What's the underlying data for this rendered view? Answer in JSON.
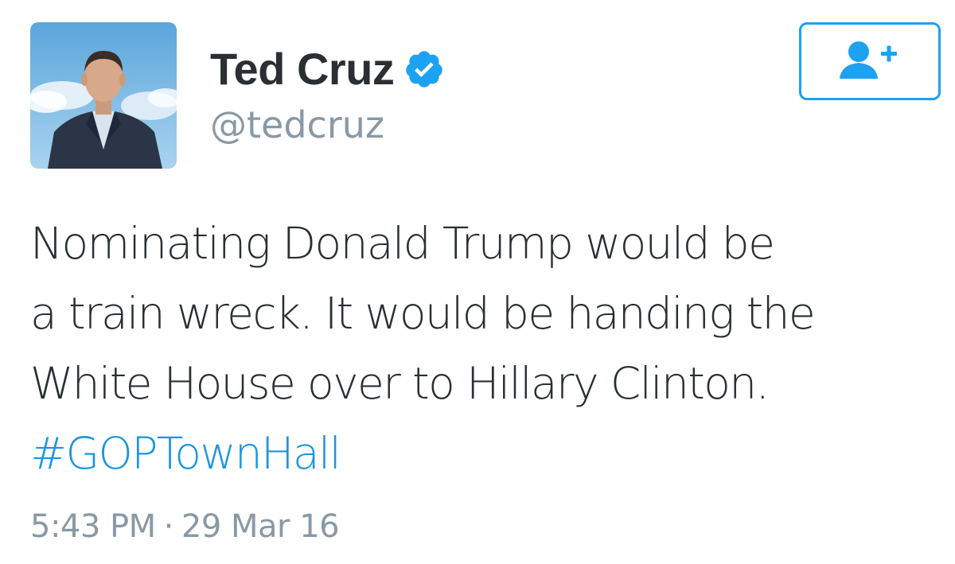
{
  "author": {
    "display_name": "Ted Cruz",
    "handle": "@tedcruz",
    "verified": true,
    "avatar": "profile-photo"
  },
  "follow_button": {
    "icon": "follow-user-icon",
    "accent_color": "#1da1f2"
  },
  "tweet": {
    "lines": [
      "Nominating Donald Trump would be",
      "a train wreck. It would be handing the",
      "White House over to Hillary Clinton."
    ],
    "hashtag": "#GOPTownHall",
    "hashtag_color": "#1b95e0"
  },
  "meta": {
    "time": "5:43 PM",
    "separator": "·",
    "date": "29 Mar 16"
  }
}
